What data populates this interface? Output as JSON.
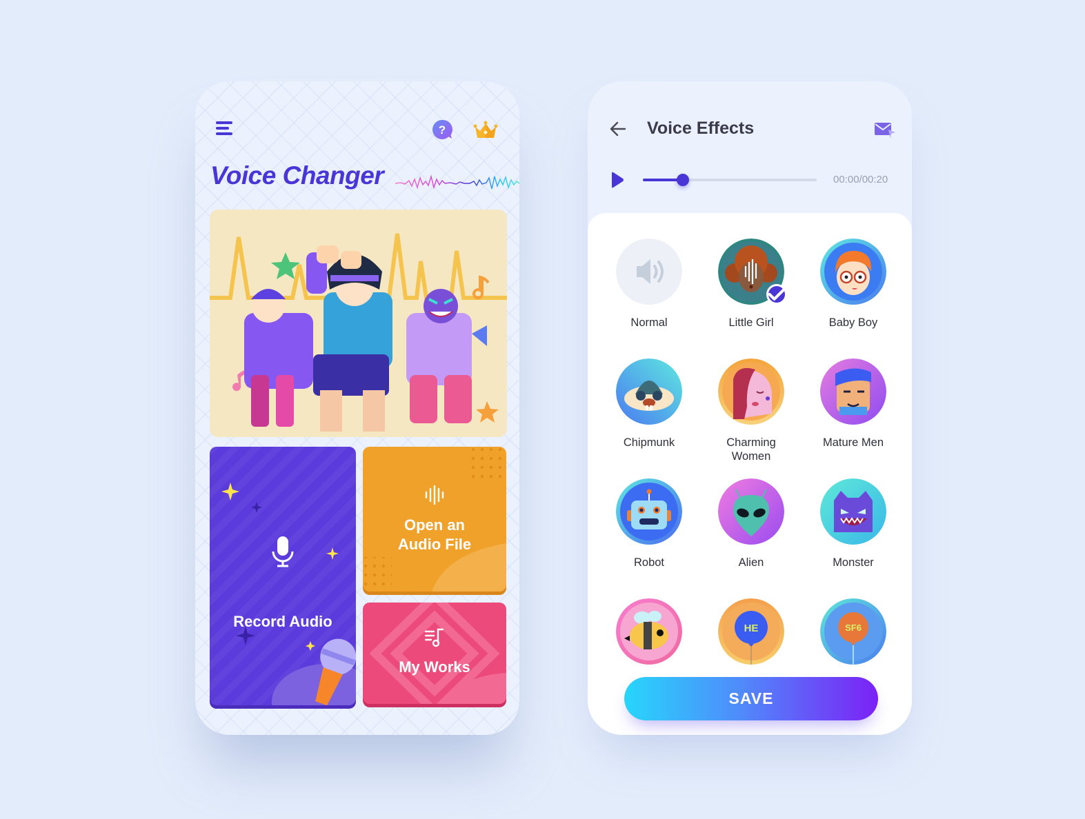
{
  "home": {
    "title": "Voice Changer",
    "icons": {
      "menu": "hamburger-menu-icon",
      "help": "help-question-icon",
      "premium": "crown-icon"
    },
    "hero_image": "dancing-singers-illustration",
    "tiles": [
      {
        "label": "Record Audio",
        "icon": "microphone-icon",
        "color": "#5c3bdc"
      },
      {
        "label": "Open an Audio File",
        "line1": "Open an",
        "line2": "Audio File",
        "icon": "waveform-icon",
        "color": "#f0a12a"
      },
      {
        "label": "My Works",
        "icon": "music-list-icon",
        "color": "#ec4a7a"
      }
    ]
  },
  "effects_screen": {
    "title": "Voice Effects",
    "icons": {
      "back": "arrow-left-icon",
      "share": "mail-send-icon",
      "play": "play-icon"
    },
    "player": {
      "current_time": "00:00",
      "total_time": "00:20",
      "time_display": "00:00/00:20",
      "progress": 0.23
    },
    "selected_effect": "Little Girl",
    "effects": [
      {
        "label": "Normal",
        "line1": "Normal",
        "line2": "",
        "icon": "speaker-icon",
        "selected": false
      },
      {
        "label": "Little Girl",
        "line1": "Little Girl",
        "line2": "",
        "icon": "little-girl-avatar",
        "selected": true
      },
      {
        "label": "Baby Boy",
        "line1": "Baby Boy",
        "line2": "",
        "icon": "baby-boy-avatar",
        "selected": false
      },
      {
        "label": "Chipmunk",
        "line1": "Chipmunk",
        "line2": "",
        "icon": "chipmunk-avatar",
        "selected": false
      },
      {
        "label": "Charming Women",
        "line1": "Charming",
        "line2": "Women",
        "icon": "charming-woman-avatar",
        "selected": false
      },
      {
        "label": "Mature Men",
        "line1": "Mature Men",
        "line2": "",
        "icon": "mature-man-avatar",
        "selected": false
      },
      {
        "label": "Robot",
        "line1": "Robot",
        "line2": "",
        "icon": "robot-avatar",
        "selected": false
      },
      {
        "label": "Alien",
        "line1": "Alien",
        "line2": "",
        "icon": "alien-avatar",
        "selected": false
      },
      {
        "label": "Monster",
        "line1": "Monster",
        "line2": "",
        "icon": "monster-avatar",
        "selected": false
      },
      {
        "label": "",
        "line1": "",
        "line2": "",
        "icon": "bee-avatar",
        "selected": false
      },
      {
        "label": "",
        "line1": "",
        "line2": "",
        "icon": "helium-balloon-avatar",
        "badge_text": "HE",
        "selected": false
      },
      {
        "label": "",
        "line1": "",
        "line2": "",
        "icon": "sf6-balloon-avatar",
        "badge_text": "SF6",
        "selected": false
      }
    ],
    "save_label": "SAVE"
  },
  "colors": {
    "primary": "#4a35d6",
    "background": "#e3ecfb",
    "save_gradient_start": "#27d6fb",
    "save_gradient_end": "#7c21f5"
  }
}
